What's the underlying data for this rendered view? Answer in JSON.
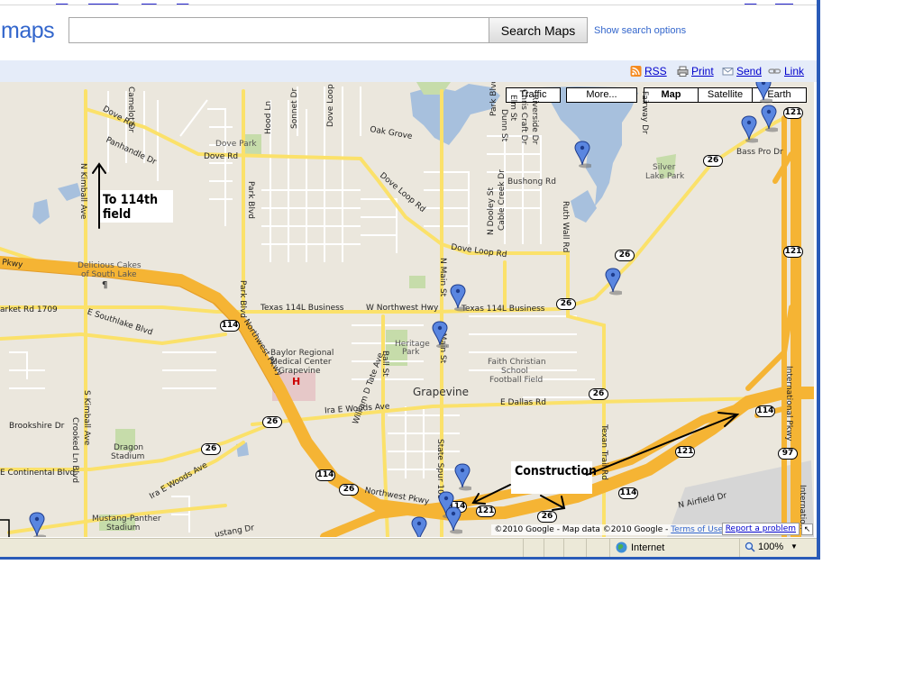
{
  "search": {
    "logo_text": "maps",
    "query": "",
    "button_label": "Search Maps",
    "options_link": "Show search options"
  },
  "link_bar": {
    "rss": "RSS",
    "print": "Print",
    "send": "Send",
    "link": "Link"
  },
  "map_controls": {
    "traffic": "Traffic",
    "more": "More...",
    "map": "Map",
    "satellite": "Satellite",
    "earth": "Earth",
    "active": "Map"
  },
  "annotations": {
    "field_note": "To 114th field",
    "construction_note": "Construction"
  },
  "map_labels": {
    "city": "Grapevine",
    "places": [
      "Dove Park",
      "Delicious Cakes",
      "of South Lake",
      "Baylor Regional",
      "Medical Center",
      "Grapevine",
      "Heritage",
      "Park",
      "Faith Christian",
      "School",
      "Football Field",
      "Dragon",
      "Stadium",
      "Mustang-Panther",
      "Stadium",
      "Silver",
      "Lake Park",
      "Bushong Rd",
      "Bass Pro Dr"
    ],
    "roads": [
      "Dove Rd",
      "Dove Rd",
      "Dove Loop Rd",
      "Dove Loop Rd",
      "Texas 114L Business",
      "W Northwest Hwy",
      "Texas 114L Business",
      "E Southlake Blvd",
      "arket Rd 1709",
      "Ira E Woods Ave",
      "E Dallas Rd",
      "Northwest Pkwy",
      "Northwest Pkwy",
      "Ira E Woods Ave",
      "Brookshire Dr",
      "E Continental Blvd",
      "Pkwy",
      "N Airfield Dr",
      "Oak Grove",
      "Panhandle Dr",
      "N Kimball Ave",
      "Park Blvd",
      "Park Blvd",
      "S Main St",
      "N Main St",
      "Ball St",
      "William D Tate Ave",
      "State Spur 103",
      "Texan Trail Rd",
      "International Pkwy",
      "S Kimball Ave",
      "Crooked Ln Blvd",
      "N Dooley St",
      "Cable Creek Dr",
      "Ruth Wall Rd",
      "Dunn St",
      "Camelot Dr",
      "Sonnet Dr",
      "Dove Loop Rd",
      "Hood Ln",
      "Park Blvd",
      "Elm St",
      "Chris Craft Dr",
      "Riverside Dr",
      "Fairway Dr",
      "Internation",
      "ustang Dr"
    ],
    "shields": [
      "121",
      "121",
      "26",
      "26",
      "26",
      "114",
      "114",
      "114",
      "121",
      "121",
      "114",
      "97",
      "26",
      "26",
      "26",
      "26",
      "121",
      "114",
      "26"
    ]
  },
  "map_footer": {
    "copyright": "©2010 Google - Map data ©2010 Google -",
    "terms": "Terms of Use",
    "report": "Report a problem"
  },
  "status_bar": {
    "zone": "Internet",
    "zoom": "100%"
  },
  "colors": {
    "highway": "#f5b434",
    "arterial": "#fbe16a",
    "street": "#ffffff",
    "water": "#a7c0dd",
    "park": "#c6dcaa",
    "land": "#ebe7dd",
    "pin": "#5a86e0",
    "frame": "#2a5bb8",
    "link": "#3366cc"
  }
}
